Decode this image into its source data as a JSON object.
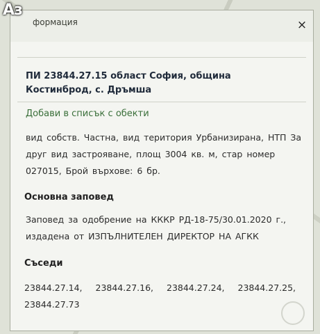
{
  "badge": {
    "text": "Аз"
  },
  "window": {
    "title": "формация",
    "close_glyph": "×"
  },
  "property": {
    "heading": "ПИ 23844.27.15 област София, община Костинброд, с. Дръмша",
    "add_link": "Добави в списък с обекти",
    "description": "вид собств. Частна, вид територия Урбанизирана, НТП За друг вид застрояване, площ 3004 кв. м, стар номер 027015, Брой върхове: 6 бр."
  },
  "order": {
    "title": "Основна заповед",
    "text": "Заповед за одобрение на КККР РД-18-75/30.01.2020 г., издадена от ИЗПЪЛНИТЕЛЕН ДИРЕКТОР НА АГКК"
  },
  "neighbors": {
    "title": "Съседи",
    "items": [
      "23844.27.14,",
      "23844.27.16,",
      "23844.27.24,",
      "23844.27.25,",
      "23844.27.73"
    ]
  }
}
